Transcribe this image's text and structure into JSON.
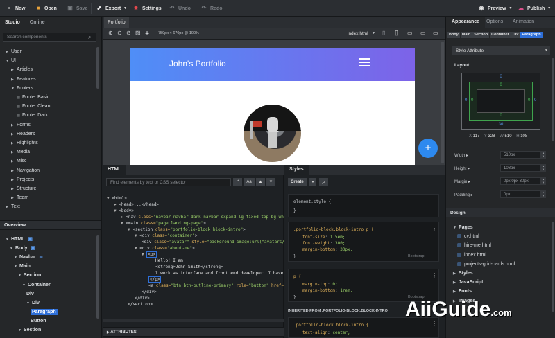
{
  "toolbar": {
    "new": "New",
    "open": "Open",
    "save": "Save",
    "export": "Export",
    "settings": "Settings",
    "undo": "Undo",
    "redo": "Redo",
    "preview": "Preview",
    "publish": "Publish"
  },
  "left": {
    "tabs": [
      "Studio",
      "Online"
    ],
    "search_placeholder": "Search components",
    "tree": [
      {
        "label": "User",
        "level": 0,
        "open": false
      },
      {
        "label": "UI",
        "level": 0,
        "open": true
      },
      {
        "label": "Articles",
        "level": 1,
        "open": false
      },
      {
        "label": "Features",
        "level": 1,
        "open": false
      },
      {
        "label": "Footers",
        "level": 1,
        "open": true
      },
      {
        "label": "Footer Basic",
        "level": 2,
        "leaf": true
      },
      {
        "label": "Footer Clean",
        "level": 2,
        "leaf": true
      },
      {
        "label": "Footer Dark",
        "level": 2,
        "leaf": true
      },
      {
        "label": "Forms",
        "level": 1,
        "open": false
      },
      {
        "label": "Headers",
        "level": 1,
        "open": false
      },
      {
        "label": "Highlights",
        "level": 1,
        "open": false
      },
      {
        "label": "Media",
        "level": 1,
        "open": false
      },
      {
        "label": "Misc",
        "level": 1,
        "open": false
      },
      {
        "label": "Navigation",
        "level": 1,
        "open": false
      },
      {
        "label": "Projects",
        "level": 1,
        "open": false
      },
      {
        "label": "Structure",
        "level": 1,
        "open": false
      },
      {
        "label": "Team",
        "level": 1,
        "open": false
      },
      {
        "label": "Text",
        "level": 0,
        "open": false
      }
    ],
    "overview_title": "Overview",
    "overview": [
      {
        "label": "HTML",
        "level": 0,
        "icon": "lock-icon"
      },
      {
        "label": "Body",
        "level": 1,
        "icon": "lock-icon"
      },
      {
        "label": "Navbar",
        "level": 2,
        "icon": "link-icon"
      },
      {
        "label": "Main",
        "level": 2
      },
      {
        "label": "Section",
        "level": 3
      },
      {
        "label": "Container",
        "level": 4
      },
      {
        "label": "Div",
        "level": 5,
        "leaf": true
      },
      {
        "label": "Div",
        "level": 5
      },
      {
        "label": "Paragraph",
        "level": 6,
        "leaf": true,
        "selected": true
      },
      {
        "label": "Button",
        "level": 6,
        "leaf": true
      },
      {
        "label": "Section",
        "level": 3
      }
    ]
  },
  "canvas": {
    "tab": "Portfolio",
    "zoom_label": "750px × 670px @ 100%",
    "file": "index.html",
    "page_title": "John's Portfolio"
  },
  "html_panel": {
    "title": "HTML",
    "search_placeholder": "Find elements by text or CSS selector",
    "aa": "Aa",
    "attributes": "ATTRIBUTES"
  },
  "styles_panel": {
    "title": "Styles",
    "create": "Create",
    "rules": [
      {
        "selector": "element.style {",
        "props": [],
        "close": "}"
      },
      {
        "selector": ".portfolio-block.block-intro p {",
        "props": [
          [
            "font-size",
            "1.5em;"
          ],
          [
            "font-weight",
            "300;"
          ],
          [
            "margin-bottom",
            "30px;"
          ]
        ],
        "close": "}",
        "source": "Bootstrap"
      },
      {
        "selector": "p {",
        "props": [
          [
            "margin-top",
            "0;"
          ],
          [
            "margin-bottom",
            "1rem;"
          ]
        ],
        "close": "}",
        "source": "Bootstrap"
      }
    ],
    "inherited": "INHERITED FROM .PORTFOLIO-BLOCK.BLOCK-INTRO",
    "inherited_rule": {
      "selector": ".portfolio-block.block-intro {",
      "props": [
        [
          "text-align",
          "center;"
        ]
      ]
    }
  },
  "right": {
    "tabs": [
      "Appearance",
      "Options",
      "Animation"
    ],
    "crumbs": [
      "Body",
      "Main",
      "Section",
      "Container",
      "Div",
      "Paragraph"
    ],
    "dropdown": "Style Attribute",
    "layout_title": "Layout",
    "box": {
      "margin_top": "0",
      "margin_bottom": "30",
      "margin_left": "0",
      "margin_right": "0",
      "padding_top": "0",
      "padding_bottom": "0",
      "padding_left": "0",
      "padding_right": "0"
    },
    "metrics": {
      "x": "117",
      "y": "328",
      "w": "510",
      "h": "108"
    },
    "fields": [
      {
        "label": "Width",
        "value": "510px"
      },
      {
        "label": "Height",
        "value": "108px"
      },
      {
        "label": "Margin",
        "value": "0px 0px 30px"
      },
      {
        "label": "Padding",
        "value": "0px"
      }
    ],
    "design_title": "Design",
    "design": [
      {
        "label": "Pages",
        "folder": true,
        "open": true
      },
      {
        "label": "cv.html",
        "file": true
      },
      {
        "label": "hire-me.html",
        "file": true
      },
      {
        "label": "index.html",
        "file": true
      },
      {
        "label": "projects-grid-cards.html",
        "file": true
      },
      {
        "label": "Styles",
        "folder": true
      },
      {
        "label": "JavaScript",
        "folder": true
      },
      {
        "label": "Fonts",
        "folder": true
      },
      {
        "label": "Images",
        "folder": true
      }
    ]
  },
  "watermark": {
    "text": "AiiGuide",
    "suffix": ".com"
  },
  "colors": {
    "accent": "#2e6fd8",
    "header_from": "#4f8ef7",
    "header_to": "#7d63e8",
    "fab": "#2d89ef"
  }
}
